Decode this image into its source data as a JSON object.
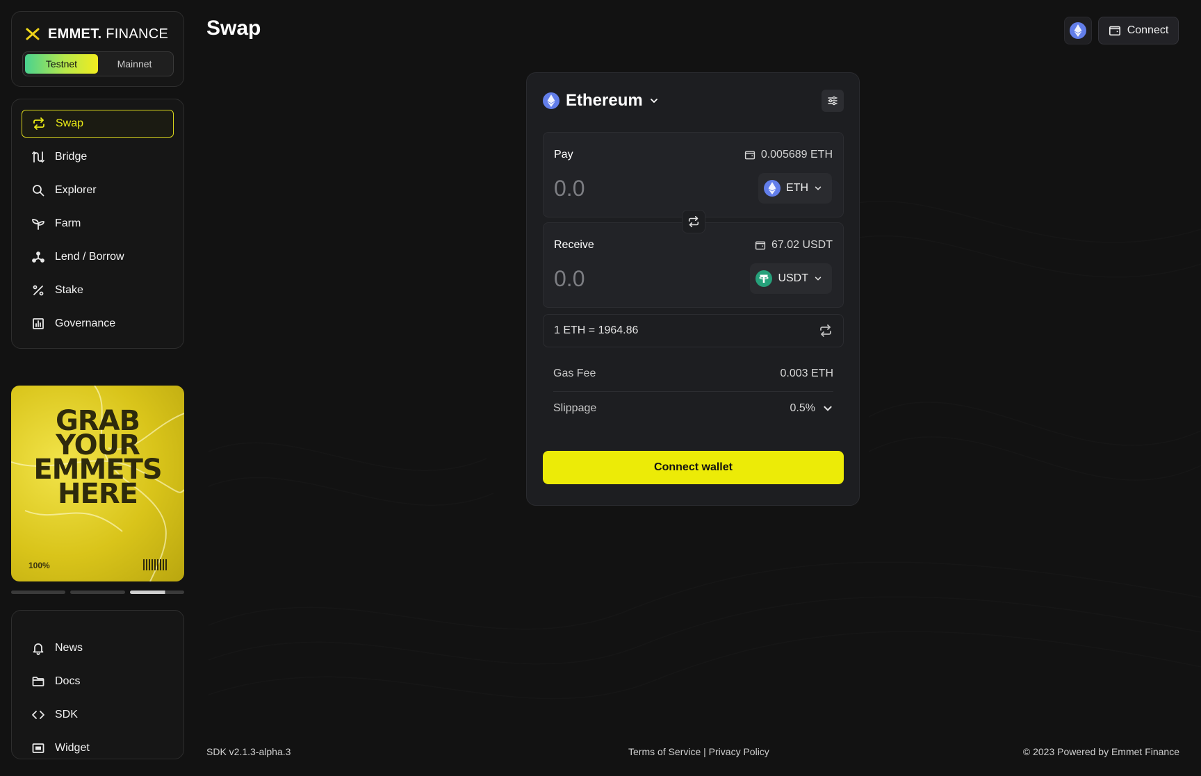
{
  "brand": {
    "name_bold": "EMMET",
    "name_dot": ".",
    "name_light": "FINANCE"
  },
  "network": {
    "options": [
      "Testnet",
      "Mainnet"
    ],
    "selected": "Testnet"
  },
  "nav": {
    "items": [
      {
        "label": "Swap",
        "icon": "swap-icon",
        "active": true
      },
      {
        "label": "Bridge",
        "icon": "bridge-icon"
      },
      {
        "label": "Explorer",
        "icon": "search-icon"
      },
      {
        "label": "Farm",
        "icon": "sprout-icon"
      },
      {
        "label": "Lend / Borrow",
        "icon": "network-icon"
      },
      {
        "label": "Stake",
        "icon": "percent-icon"
      },
      {
        "label": "Governance",
        "icon": "chart-icon"
      }
    ]
  },
  "promo": {
    "line1": "GRAB",
    "line2": "YOUR",
    "line3": "EMMETS",
    "line4": "HERE",
    "percent": "100%"
  },
  "secondary_nav": {
    "items": [
      {
        "label": "News",
        "icon": "bell-icon"
      },
      {
        "label": "Docs",
        "icon": "folder-icon"
      },
      {
        "label": "SDK",
        "icon": "code-icon"
      },
      {
        "label": "Widget",
        "icon": "widget-icon"
      }
    ]
  },
  "header": {
    "title": "Swap",
    "connect_label": "Connect"
  },
  "swap": {
    "chain": "Ethereum",
    "pay": {
      "label": "Pay",
      "balance": "0.005689 ETH",
      "amount": "0.0",
      "token": "ETH"
    },
    "receive": {
      "label": "Receive",
      "balance": "67.02 USDT",
      "amount": "0.0",
      "token": "USDT"
    },
    "rate": "1 ETH = 1964.86",
    "gas_fee": {
      "label": "Gas Fee",
      "value": "0.003 ETH"
    },
    "slippage": {
      "label": "Slippage",
      "value": "0.5%"
    },
    "cta": "Connect wallet"
  },
  "footer": {
    "version": "SDK v2.1.3-alpha.3",
    "terms": "Terms of Service",
    "separator": "|",
    "privacy": "Privacy Policy",
    "copyright": "© 2023 Powered by Emmet Finance"
  },
  "colors": {
    "accent": "#eceb07",
    "background": "#121212",
    "card": "#1d1e21",
    "eth": "#627eea",
    "usdt": "#26a17b"
  }
}
